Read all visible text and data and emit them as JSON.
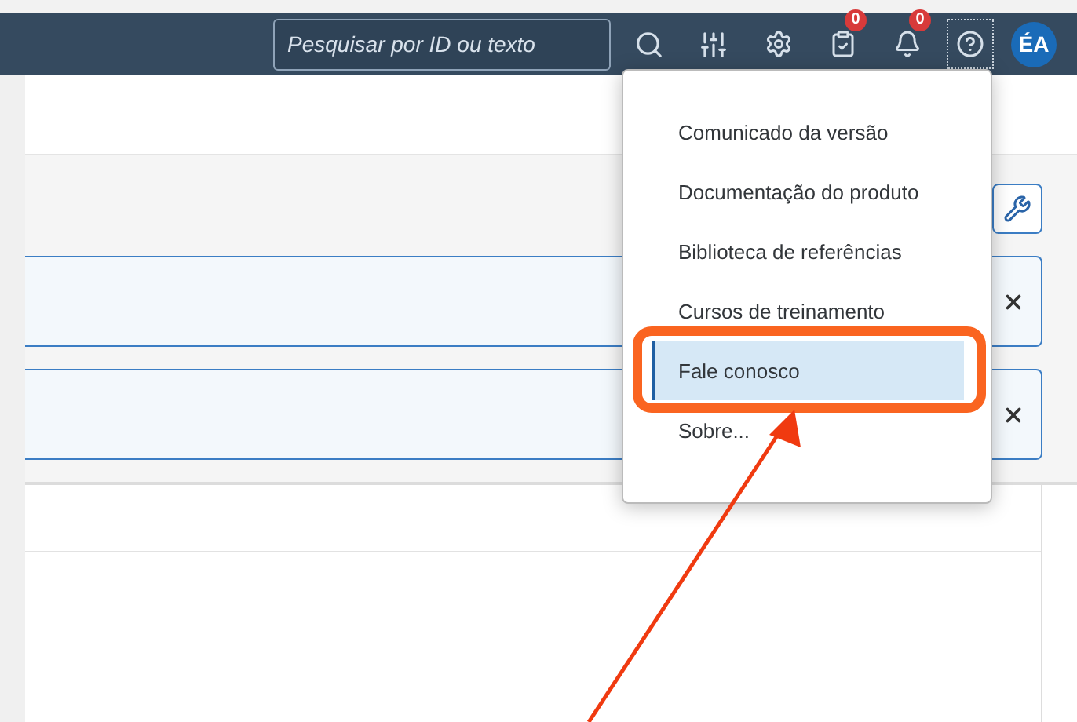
{
  "header": {
    "search": {
      "placeholder": "Pesquisar por ID ou texto"
    },
    "tasks_badge": "0",
    "notifications_badge": "0",
    "help_focused": true,
    "avatar": "ÉA"
  },
  "help_menu": {
    "items": [
      {
        "label": "Comunicado da versão",
        "selected": false
      },
      {
        "label": "Documentação do produto",
        "selected": false
      },
      {
        "label": "Biblioteca de referências",
        "selected": false
      },
      {
        "label": "Cursos de treinamento",
        "selected": false
      },
      {
        "label": "Fale conosco",
        "selected": true
      },
      {
        "label": "Sobre...",
        "selected": false
      }
    ]
  },
  "annotations": [
    {
      "kind": "highlight"
    },
    {
      "kind": "arrow"
    }
  ]
}
